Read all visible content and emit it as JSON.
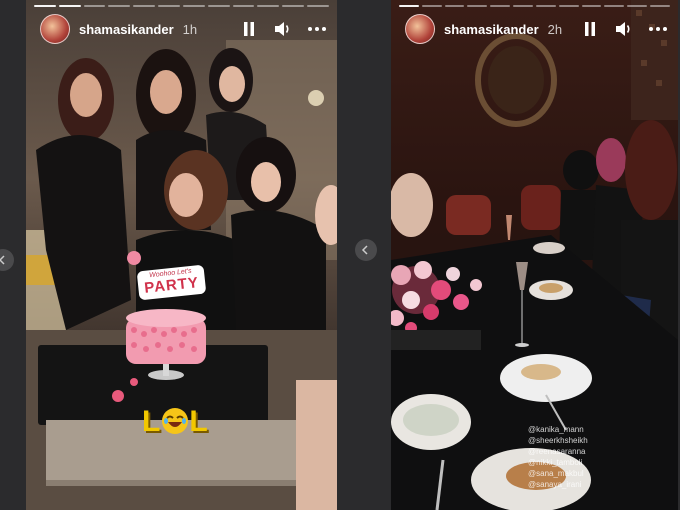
{
  "stories": [
    {
      "username": "shamasikander",
      "time": "1h",
      "progress_done": 2,
      "progress_total": 12,
      "sign_small": "Woohoo Let's",
      "sign_big": "PARTY",
      "sticker_left": "L",
      "sticker_right": "L"
    },
    {
      "username": "shamasikander",
      "time": "2h",
      "progress_done": 1,
      "progress_total": 12,
      "tags": [
        "@kanika_mann",
        "@sheerkhsheikh",
        "@reenasaranna",
        "@nikki_tamboli",
        "@sana_makbul",
        "@sanaya_irani"
      ]
    }
  ],
  "icons": {
    "pause": "pause-icon",
    "volume": "volume-icon",
    "more": "more-icon",
    "prev": "chevron-left-icon"
  }
}
